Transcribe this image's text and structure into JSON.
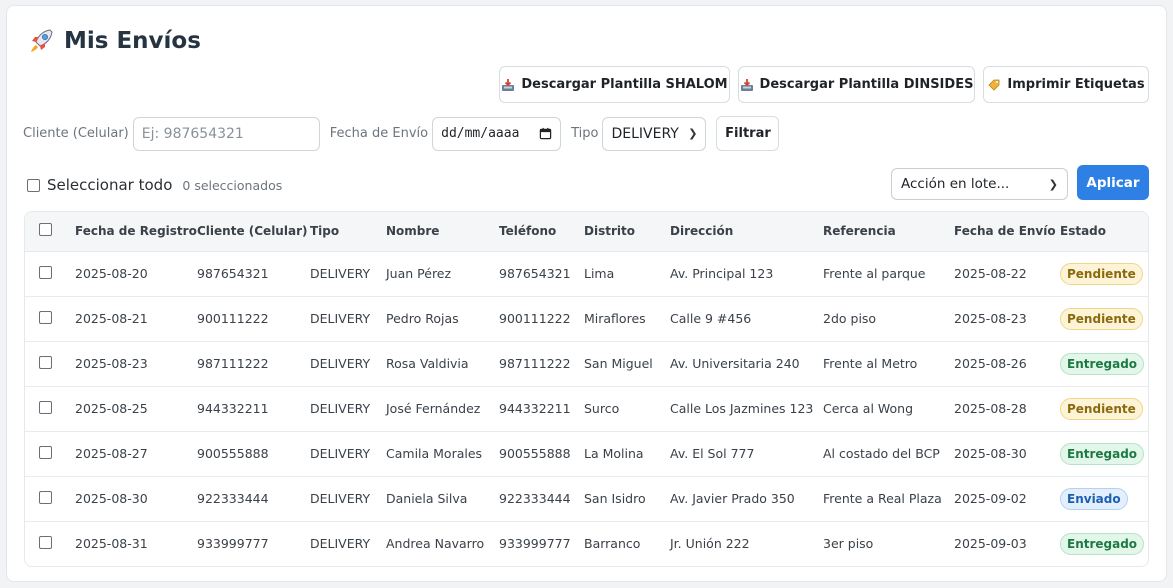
{
  "page": {
    "title": "Mis Envíos"
  },
  "toolbar": {
    "shalom_label": "Descargar Plantilla SHALOM",
    "dinsides_label": "Descargar Plantilla DINSIDES",
    "print_label": "Imprimir Etiquetas"
  },
  "filters": {
    "client_label": "Cliente (Celular)",
    "client_placeholder": "Ej: 987654321",
    "date_label": "Fecha de Envío",
    "date_value": "dd/mm/aaaa",
    "type_label": "Tipo",
    "type_value": "DELIVERY",
    "filter_button": "Filtrar"
  },
  "selection": {
    "select_all_label": "Seleccionar todo",
    "count_text": "0 seleccionados",
    "batch_placeholder": "Acción en lote...",
    "apply_button": "Aplicar"
  },
  "table": {
    "headers": [
      "Fecha de Registro",
      "Cliente (Celular)",
      "Tipo",
      "Nombre",
      "Teléfono",
      "Distrito",
      "Dirección",
      "Referencia",
      "Fecha de Envío",
      "Estado"
    ],
    "rows": [
      {
        "registro": "2025-08-20",
        "cliente": "987654321",
        "tipo": "DELIVERY",
        "nombre": "Juan Pérez",
        "telefono": "987654321",
        "distrito": "Lima",
        "direccion": "Av. Principal 123",
        "referencia": "Frente al parque",
        "envio": "2025-08-22",
        "estado": "Pendiente"
      },
      {
        "registro": "2025-08-21",
        "cliente": "900111222",
        "tipo": "DELIVERY",
        "nombre": "Pedro Rojas",
        "telefono": "900111222",
        "distrito": "Miraflores",
        "direccion": "Calle 9 #456",
        "referencia": "2do piso",
        "envio": "2025-08-23",
        "estado": "Pendiente"
      },
      {
        "registro": "2025-08-23",
        "cliente": "987111222",
        "tipo": "DELIVERY",
        "nombre": "Rosa Valdivia",
        "telefono": "987111222",
        "distrito": "San Miguel",
        "direccion": "Av. Universitaria 240",
        "referencia": "Frente al Metro",
        "envio": "2025-08-26",
        "estado": "Entregado"
      },
      {
        "registro": "2025-08-25",
        "cliente": "944332211",
        "tipo": "DELIVERY",
        "nombre": "José Fernández",
        "telefono": "944332211",
        "distrito": "Surco",
        "direccion": "Calle Los Jazmines 123",
        "referencia": "Cerca al Wong",
        "envio": "2025-08-28",
        "estado": "Pendiente"
      },
      {
        "registro": "2025-08-27",
        "cliente": "900555888",
        "tipo": "DELIVERY",
        "nombre": "Camila Morales",
        "telefono": "900555888",
        "distrito": "La Molina",
        "direccion": "Av. El Sol 777",
        "referencia": "Al costado del BCP",
        "envio": "2025-08-30",
        "estado": "Entregado"
      },
      {
        "registro": "2025-08-30",
        "cliente": "922333444",
        "tipo": "DELIVERY",
        "nombre": "Daniela Silva",
        "telefono": "922333444",
        "distrito": "San Isidro",
        "direccion": "Av. Javier Prado 350",
        "referencia": "Frente a Real Plaza",
        "envio": "2025-09-02",
        "estado": "Enviado"
      },
      {
        "registro": "2025-08-31",
        "cliente": "933999777",
        "tipo": "DELIVERY",
        "nombre": "Andrea Navarro",
        "telefono": "933999777",
        "distrito": "Barranco",
        "direccion": "Jr. Unión 222",
        "referencia": "3er piso",
        "envio": "2025-09-03",
        "estado": "Entregado"
      }
    ]
  },
  "status_colors": {
    "Pendiente": "#fdf4d7",
    "Entregado": "#e3f6ea",
    "Enviado": "#e3effc"
  },
  "accent_color": "#2f80e4"
}
